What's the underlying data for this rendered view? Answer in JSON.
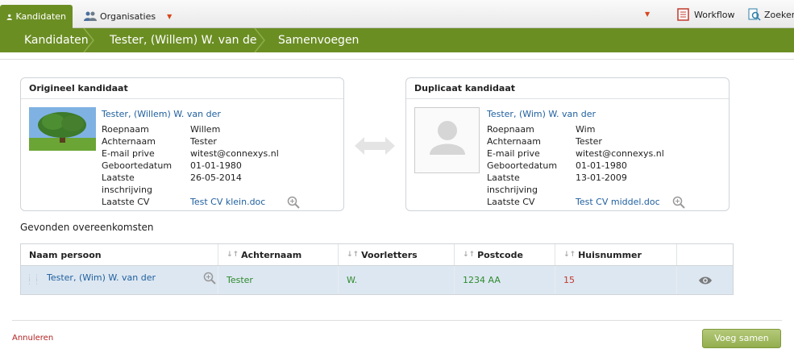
{
  "tabs": {
    "kandidaten": "Kandidaten",
    "organisaties": "Organisaties"
  },
  "topright": {
    "workflow": "Workflow",
    "zoeken": "Zoeken"
  },
  "breadcrumb": [
    "Kandidaten",
    "Tester, (Willem) W. van de",
    "Samenvoegen"
  ],
  "original": {
    "header": "Origineel kandidaat",
    "name": "Tester, (Willem) W. van der",
    "labels": [
      "Roepnaam",
      "Achternaam",
      "E-mail prive",
      "Geboortedatum",
      "Laatste",
      "inschrijving",
      "Laatste CV"
    ],
    "values": [
      "Willem",
      "Tester",
      "witest@connexys.nl",
      "01-01-1980",
      "26-05-2014",
      "",
      "Test CV klein.doc"
    ]
  },
  "duplicate": {
    "header": "Duplicaat kandidaat",
    "name": "Tester, (Wim) W. van der",
    "labels": [
      "Roepnaam",
      "Achternaam",
      "E-mail prive",
      "Geboortedatum",
      "Laatste",
      "inschrijving",
      "Laatste CV"
    ],
    "values": [
      "Wim",
      "Tester",
      "witest@connexys.nl",
      "01-01-1980",
      "13-01-2009",
      "",
      "Test CV middel.doc"
    ]
  },
  "matches": {
    "title": "Gevonden overeenkomsten",
    "columns": [
      "Naam persoon",
      "Achternaam",
      "Voorletters",
      "Postcode",
      "Huisnummer"
    ],
    "rows": [
      {
        "naam": "Tester, (Wim) W. van der",
        "achternaam": "Tester",
        "voorletters": "W.",
        "postcode": "1234 AA",
        "huisnummer": "15"
      }
    ]
  },
  "footer": {
    "cancel": "Annuleren",
    "merge": "Voeg samen"
  },
  "colors": {
    "brand_green": "#6b8e23",
    "link_blue": "#1f5f9e",
    "row_highlight": "#dde7f1",
    "danger_red": "#b22222"
  },
  "icons": [
    "user-icon",
    "organisations-icon",
    "workflow-icon",
    "search-icon",
    "zoom-icon",
    "swap-arrows-icon",
    "eye-icon",
    "drag-handle-icon"
  ]
}
